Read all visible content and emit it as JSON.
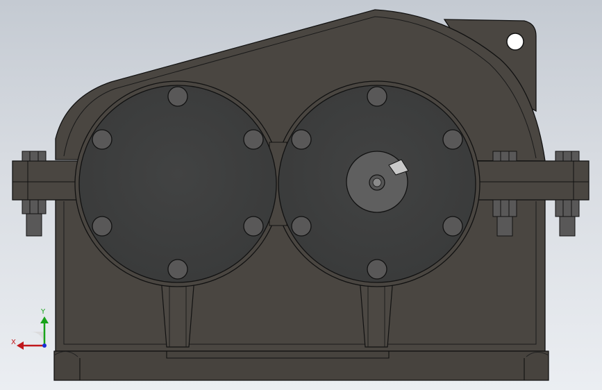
{
  "viewport": {
    "background_top": "#c4cad2",
    "background_bottom": "#ebeef2"
  },
  "model": {
    "body_color": "#4a4641",
    "cover_color": "#3c3d3d",
    "bolt_color": "#595858",
    "outline_color": "#111111",
    "shaft_color": "#5f5f5f",
    "key_color": "#c9c9c9"
  },
  "triad": {
    "x_label": "X",
    "y_label": "Y",
    "x_color": "#c0171b",
    "y_color": "#18a31a",
    "z_color": "#1a2ed6"
  }
}
